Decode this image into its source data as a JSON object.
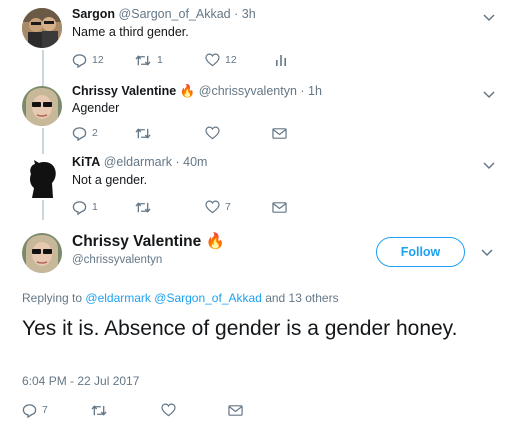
{
  "replies": [
    {
      "name": "Sargon",
      "handle": "@Sargon_of_Akkad",
      "time": "· 3h",
      "text": "Name a third gender.",
      "counts": {
        "reply": "12",
        "retweet": "1",
        "like": "12"
      }
    },
    {
      "name": "Chrissy Valentine",
      "emoji": "🔥",
      "handle": "@chrissyvalentyn",
      "time": "· 1h",
      "text": "Agender",
      "counts": {
        "reply": "2",
        "retweet": "",
        "like": ""
      }
    },
    {
      "name": "KiTA",
      "handle": "@eldarmark",
      "time": "· 40m",
      "text": "Not a gender.",
      "counts": {
        "reply": "1",
        "retweet": "",
        "like": "7"
      }
    }
  ],
  "main": {
    "name": "Chrissy Valentine",
    "emoji": "🔥",
    "handle": "@chrissyvalentyn",
    "follow_label": "Follow",
    "replying_prefix": "Replying to",
    "replying_users": "@eldarmark @Sargon_of_Akkad",
    "replying_suffix": "and 13 others",
    "text": "Yes it is. Absence of gender is a gender honey.",
    "timestamp": "6:04 PM - 22 Jul 2017",
    "counts": {
      "reply": "7"
    }
  },
  "icons": [
    "reply-icon",
    "retweet-icon",
    "like-icon",
    "analytics-icon",
    "direct-message-icon",
    "chevron-down-icon"
  ],
  "colors": {
    "accent": "#1da1f2",
    "secondary_text": "#657786",
    "icon": "#aab8c2",
    "fire": "#f4900c"
  }
}
